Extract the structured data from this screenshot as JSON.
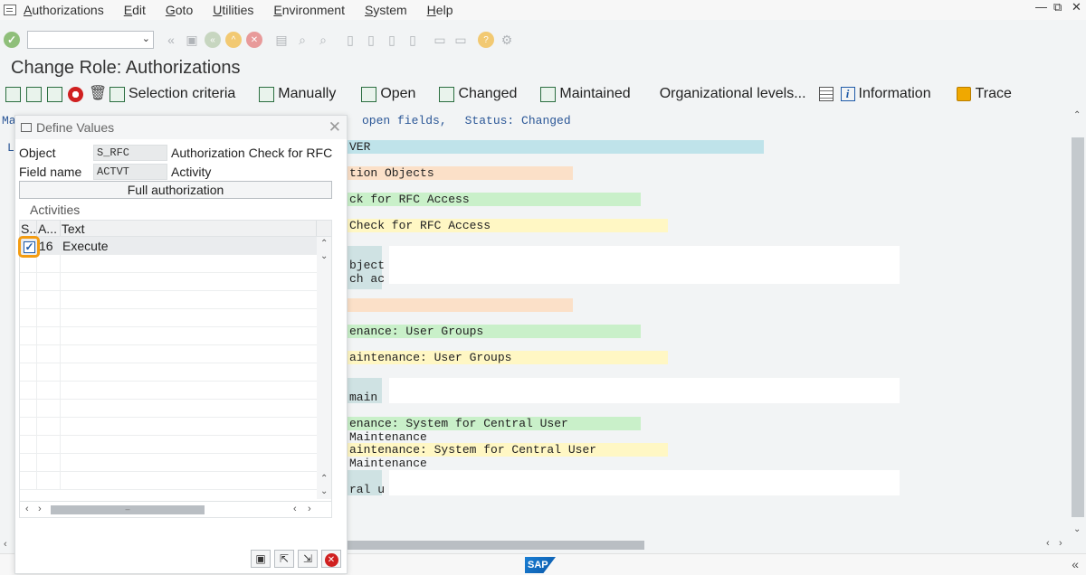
{
  "menu": [
    "Authorizations",
    "Edit",
    "Goto",
    "Utilities",
    "Environment",
    "System",
    "Help"
  ],
  "window_controls": {
    "minimize": "—",
    "restore": "⧉",
    "close": "✕"
  },
  "title": "Change Role: Authorizations",
  "toolbar": {
    "selection_criteria": "Selection criteria",
    "manually": "Manually",
    "open": "Open",
    "changed": "Changed",
    "maintained": "Maintained",
    "org_levels": "Organizational levels...",
    "information": "Information",
    "trace": "Trace"
  },
  "header": {
    "ma_prefix": "Ma",
    "l_prefix": "L",
    "open_fields": "open fields,",
    "status_label": "Status: Changed"
  },
  "background_rows": [
    "VER",
    "tion Objects",
    "ck for RFC Access",
    " Check for RFC Access",
    "bject",
    "ch ac",
    "enance: User Groups",
    "aintenance: User Groups",
    " main",
    "enance: System for Central User Maintenance",
    "aintenance: System for Central User Maintenance",
    "ral u"
  ],
  "dialog": {
    "title": "Define Values",
    "object_label": "Object",
    "object_value": "S_RFC",
    "object_desc": "Authorization Check for RFC A...",
    "field_label": "Field name",
    "field_value": "ACTVT",
    "field_desc": "Activity",
    "full_auth": "Full authorization",
    "table_title": "Activities",
    "columns": [
      "S...",
      "A...",
      "Text"
    ],
    "rows": [
      {
        "selected": true,
        "activity": "16",
        "text": "Execute"
      }
    ]
  },
  "status_bar": {
    "logo": "SAP"
  }
}
